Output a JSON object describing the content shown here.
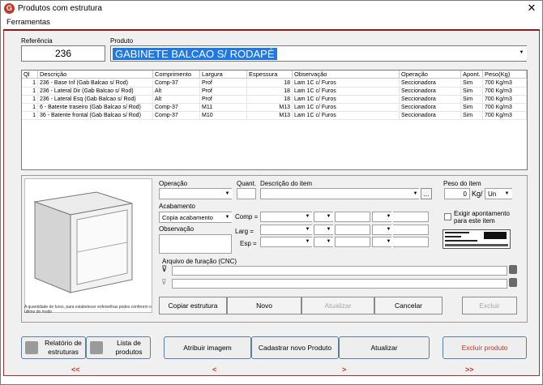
{
  "window": {
    "title": "Produtos com estrutura",
    "close": "✕"
  },
  "menu": {
    "items": [
      "Ferramentas"
    ]
  },
  "header": {
    "ref_label": "Referência",
    "ref_value": "236",
    "product_label": "Produto",
    "product_value": "GABINETE BALCAO S/ RODAPÉ"
  },
  "grid": {
    "columns": [
      "Ql",
      "Descrição",
      "Comprimento",
      "Largura",
      "Espessura",
      "Observação",
      "Operação",
      "Apont.",
      "Peso(Kg)"
    ],
    "rows": [
      [
        "1",
        "236 - Base Inf (Gab Balcao s/ Rod)",
        "Comp-37",
        "Prof",
        "18",
        "Lam 1C c/ Furos",
        "Seccionadora",
        "Sim",
        "700 Kg/m3"
      ],
      [
        "1",
        "236 - Lateral Dir (Gab Balcao s/ Rod)",
        "Alt",
        "Prof",
        "18",
        "Lam 1C c/ Furos",
        "Seccionadora",
        "Sim",
        "700 Kg/m3"
      ],
      [
        "1",
        "236 - Lateral Esq (Gab Balcao s/ Rod)",
        "Alt",
        "Prof",
        "18",
        "Lam 1C c/ Furos",
        "Seccionadora",
        "Sim",
        "700 Kg/m3"
      ],
      [
        "1",
        "6 - Batente traseiro (Gab Balcao s/ Rod)",
        "Comp-37",
        "M11",
        "M13",
        "Lam 1C c/ Furos",
        "Seccionadora",
        "Sim",
        "700 Kg/m3"
      ],
      [
        "1",
        "36 - Batente frontal (Gab Balcao s/ Rod)",
        "Comp-37",
        "M10",
        "M13",
        "Lam 1C c/ Furos",
        "Seccionadora",
        "Sim",
        "700 Kg/m3"
      ]
    ]
  },
  "details": {
    "image_caption": "A quantidade de furos, para estabelecer enfeixelhas podes conferem o ultimo do modo",
    "operacao_label": "Operação",
    "quant_label": "Quant.",
    "descricao_label": "Descrição do item",
    "desc_button": "...",
    "acabamento_label": "Acabamento",
    "acabamento_value": "Copia acabamento",
    "observacao_label": "Observação",
    "comp_label": "Comp =",
    "larg_label": "Larg =",
    "esp_label": "Esp =",
    "arquivo_label": "Arquivo de furação (CNC)",
    "peso_label": "Peso do item",
    "peso_value": "0",
    "peso_unit": "Kg/",
    "un_value": "Un",
    "exigir_label": "Exigir apontamento para este item"
  },
  "actions": {
    "copiar": "Copiar estrutura",
    "novo": "Novo",
    "atualizar": "Atualizar",
    "cancelar": "Cancelar",
    "excluir": "Excluir"
  },
  "footer": {
    "relatorio": "Relatório de estruturas",
    "lista": "Lista de produtos",
    "atribuir": "Atribuir imagem",
    "cadastrar": "Cadastrar novo Produto",
    "atualizar": "Atualizar",
    "excluir_produto": "Excluir produto",
    "nav_first": "<<",
    "nav_prev": "<",
    "nav_next": ">",
    "nav_last": ">>"
  },
  "colors": {
    "accent": "#c0392b",
    "selection": "#1e78e6",
    "frame_border": "#8b1a1a"
  }
}
